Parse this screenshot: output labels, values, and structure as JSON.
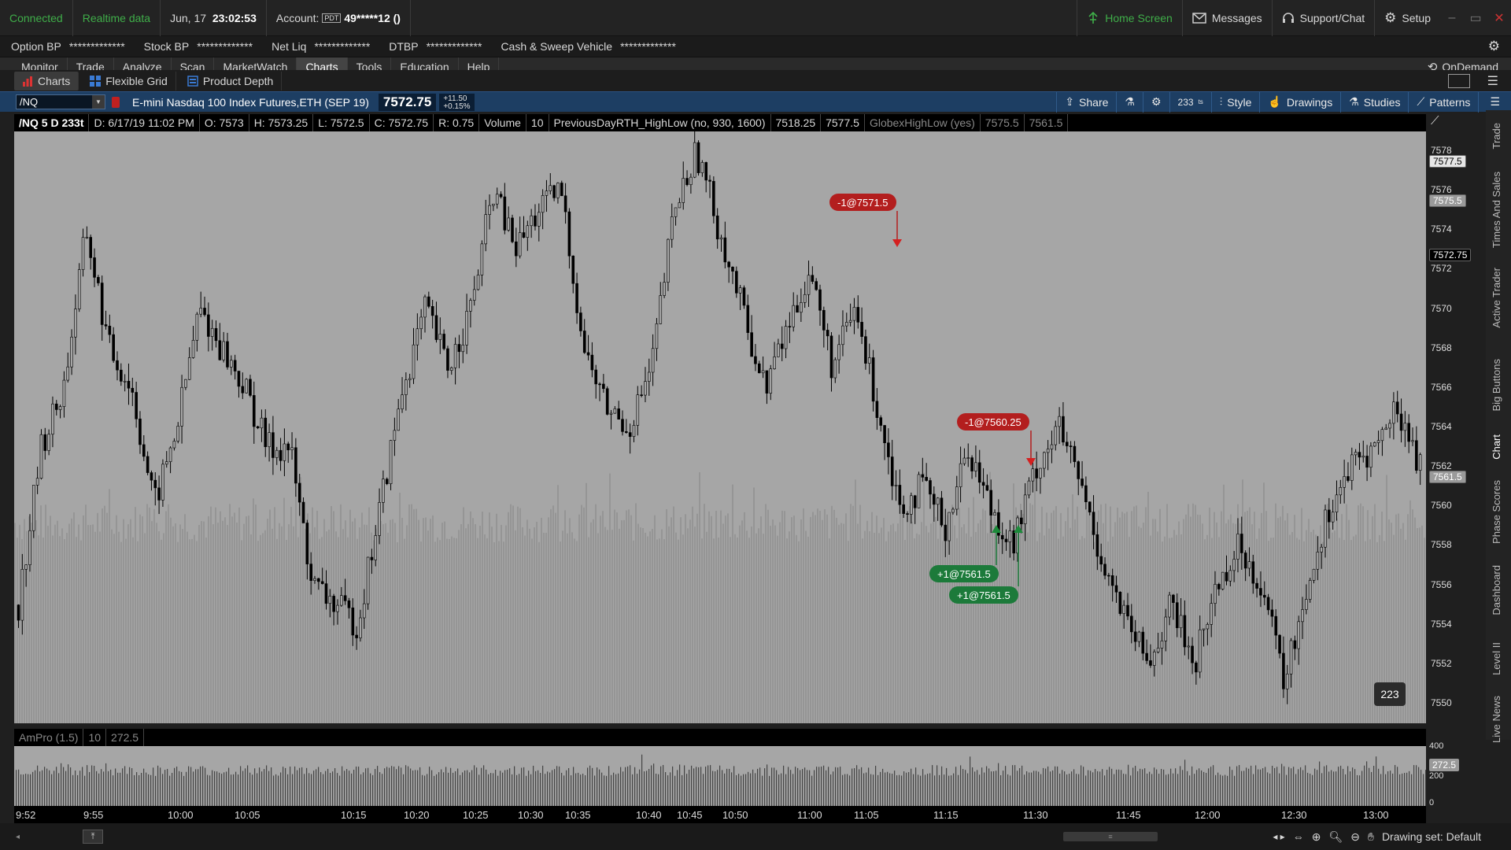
{
  "status": {
    "connection": "Connected",
    "data_mode": "Realtime data",
    "date": "Jun, 17",
    "time": "23:02:53",
    "account_label": "Account:",
    "account_badge": "PDT",
    "account_number": "49*****12 ()",
    "home_screen": "Home Screen",
    "messages": "Messages",
    "support": "Support/Chat",
    "setup": "Setup"
  },
  "balances": [
    {
      "label": "Option BP",
      "value": "*************"
    },
    {
      "label": "Stock BP",
      "value": "*************"
    },
    {
      "label": "Net Liq",
      "value": "*************"
    },
    {
      "label": "DTBP",
      "value": "*************"
    },
    {
      "label": "Cash & Sweep Vehicle",
      "value": "*************"
    }
  ],
  "menu": [
    "Monitor",
    "Trade",
    "Analyze",
    "Scan",
    "MarketWatch",
    "Charts",
    "Tools",
    "Education",
    "Help"
  ],
  "menu_active": "Charts",
  "ondemand": "OnDemand",
  "subtabs": [
    "Charts",
    "Flexible Grid",
    "Product Depth"
  ],
  "toolbar": {
    "symbol": "/NQ",
    "description": "E-mini Nasdaq 100 Index Futures,ETH (SEP 19)",
    "last_price": "7572.75",
    "change": "+11.50",
    "change_pct": "+0.15%",
    "share": "Share",
    "aggregation": "233",
    "style": "Style",
    "drawings": "Drawings",
    "studies": "Studies",
    "patterns": "Patterns"
  },
  "info": {
    "symbol_period": "/NQ 5 D 233t",
    "date": "D: 6/17/19 11:02 PM",
    "open": "O: 7573",
    "high": "H: 7573.25",
    "low": "L: 7572.5",
    "close": "C: 7572.75",
    "range": "R: 0.75",
    "volume_label": "Volume",
    "volume_value": "10",
    "study1": "PreviousDayRTH_HighLow (no, 930, 1600)",
    "study1_v1": "7518.25",
    "study1_v2": "7577.5",
    "study2": "GlobexHighLow (yes)",
    "study2_v1": "7575.5",
    "study2_v2": "7561.5"
  },
  "price_axis": {
    "ticks": [
      "7578",
      "7576",
      "7574",
      "7572",
      "7570",
      "7568",
      "7566",
      "7564",
      "7562",
      "7560",
      "7558",
      "7556",
      "7554",
      "7552",
      "7550"
    ],
    "tags": [
      {
        "label": "7577.5",
        "value": 7577.5,
        "color": "#e6e6e6",
        "text": "#000"
      },
      {
        "label": "7575.5",
        "value": 7575.5,
        "color": "#9a9a9a",
        "text": "#fff"
      },
      {
        "label": "7572.75",
        "value": 7572.75,
        "color": "#000000",
        "text": "#fff"
      },
      {
        "label": "7561.5",
        "value": 7561.5,
        "color": "#9a9a9a",
        "text": "#fff"
      }
    ]
  },
  "trades": [
    {
      "label": "-1@7571.5",
      "side": "sell"
    },
    {
      "label": "-1@7560.25",
      "side": "sell"
    },
    {
      "label": "+1@7561.5",
      "side": "buy"
    },
    {
      "label": "+1@7561.5",
      "side": "buy"
    }
  ],
  "bubble_count": "223",
  "volume_study": {
    "name": "AmPro (1.5)",
    "value1": "10",
    "value2": "272.5",
    "axis_ticks": [
      "400",
      "200",
      "0"
    ],
    "tag": "272.5"
  },
  "time_axis": [
    "9:52",
    "9:55",
    "10:00",
    "10:05",
    "10:15",
    "10:20",
    "10:25",
    "10:30",
    "10:35",
    "10:40",
    "10:45",
    "10:50",
    "11:00",
    "11:05",
    "11:15",
    "11:30",
    "11:45",
    "12:00",
    "12:30",
    "13:00"
  ],
  "right_tabs": [
    "Trade",
    "Times And Sales",
    "Active Trader",
    "Big Buttons",
    "Chart",
    "Phase Scores",
    "Dashboard",
    "Level II",
    "Live News"
  ],
  "drawing_set": "Drawing set: Default",
  "chart_data": {
    "type": "candlestick",
    "ylim": [
      7549,
      7579
    ],
    "price_path": [
      7555,
      7563,
      7566,
      7574,
      7568,
      7566,
      7560,
      7564,
      7570,
      7568,
      7566,
      7563,
      7563,
      7556,
      7555,
      7554,
      7560,
      7566,
      7570,
      7567,
      7570,
      7576,
      7573,
      7575,
      7576,
      7568,
      7565,
      7564,
      7567,
      7575,
      7578,
      7574,
      7570,
      7566,
      7569,
      7572,
      7567,
      7570,
      7565,
      7560,
      7561,
      7559,
      7563,
      7560,
      7558,
      7562,
      7564,
      7561,
      7557,
      7554,
      7552,
      7555,
      7552,
      7556,
      7558,
      7556,
      7551,
      7556,
      7560,
      7562,
      7563,
      7565,
      7562
    ]
  }
}
